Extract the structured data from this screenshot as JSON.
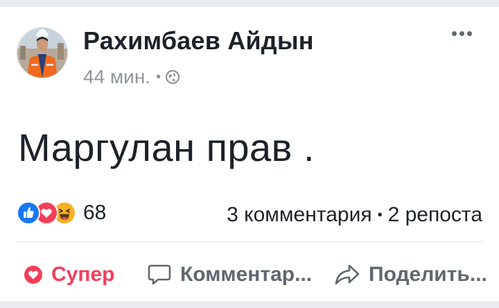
{
  "post": {
    "author": "Рахимбаев Айдын",
    "time": "44 мин.",
    "meta_separator": "•",
    "privacy_icon": "globe-icon",
    "text": "Маргулан прав ."
  },
  "engagement": {
    "reaction_icons": [
      "like-icon",
      "love-icon",
      "haha-icon"
    ],
    "reaction_count": "68",
    "comments": "3 комментария",
    "separator": "•",
    "shares": "2 репоста"
  },
  "actions": {
    "reaction_label": "Супер",
    "comment_label": "Комментар...",
    "share_label": "Поделить..."
  },
  "colors": {
    "like_blue": "#1877f2",
    "love_red": "#f33e58",
    "haha_yellow": "#f7b125",
    "text_dark": "#1d2129",
    "text_grey": "#90949c"
  }
}
